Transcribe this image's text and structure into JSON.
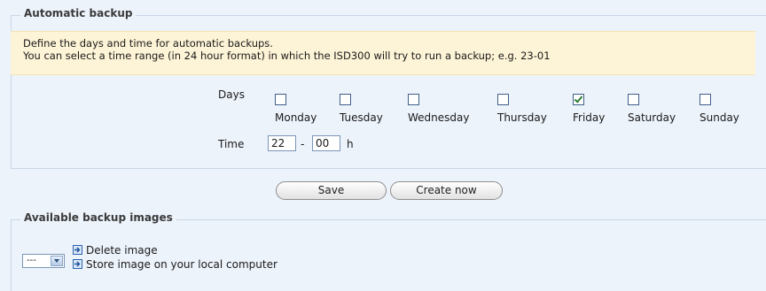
{
  "backup": {
    "legend": "Automatic backup",
    "info_line1": "Define the days and time for automatic backups.",
    "info_line2": "You can select a time range (in 24 hour format) in which the ISD300 will try to run a backup; e.g. 23-01",
    "days_label": "Days",
    "days": [
      {
        "label": "Monday",
        "checked": false
      },
      {
        "label": "Tuesday",
        "checked": false
      },
      {
        "label": "Wednesday",
        "checked": false
      },
      {
        "label": "Thursday",
        "checked": false
      },
      {
        "label": "Friday",
        "checked": true
      },
      {
        "label": "Saturday",
        "checked": false
      },
      {
        "label": "Sunday",
        "checked": false
      }
    ],
    "time_label": "Time",
    "time_from": "22",
    "time_sep": "-",
    "time_to": "00",
    "time_unit": "h",
    "save_label": "Save",
    "create_label": "Create now"
  },
  "images": {
    "legend": "Available backup images",
    "select_value": "---",
    "delete_label": "Delete image",
    "store_label": "Store image on your local computer"
  }
}
